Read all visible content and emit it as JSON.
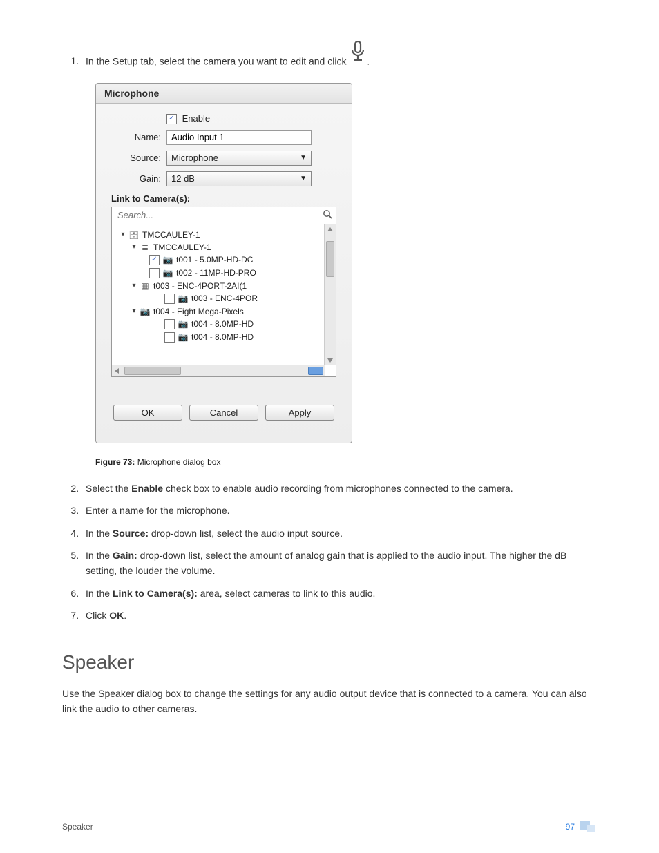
{
  "steps": {
    "s1_pre": "In the Setup tab, select the camera you want to edit and click ",
    "s1_post": ".",
    "s2_pre": "Select the ",
    "s2_b": "Enable",
    "s2_post": " check box to enable audio recording from microphones connected to the camera.",
    "s3": "Enter a name for the microphone.",
    "s4_pre": "In the ",
    "s4_b": "Source:",
    "s4_post": " drop-down list, select the audio input source.",
    "s5_pre": "In the ",
    "s5_b": "Gain:",
    "s5_post": " drop-down list, select the amount of analog gain that is applied to the audio input. The higher the dB setting, the louder the volume.",
    "s6_pre": "In the ",
    "s6_b": "Link to Camera(s):",
    "s6_post": " area, select cameras to link to this audio.",
    "s7_pre": "Click ",
    "s7_b": "OK",
    "s7_post": "."
  },
  "dialog": {
    "title": "Microphone",
    "enable_label": "Enable",
    "name_label": "Name:",
    "name_value": "Audio Input 1",
    "source_label": "Source:",
    "source_value": "Microphone",
    "gain_label": "Gain:",
    "gain_value": "12 dB",
    "link_heading": "Link to Camera(s):",
    "search_placeholder": "Search...",
    "tree": {
      "n0": "TMCCAULEY-1",
      "n1": "TMCCAULEY-1",
      "n2": "t001 - 5.0MP-HD-DC",
      "n3": "t002 - 11MP-HD-PRO",
      "n4": "t003 - ENC-4PORT-2AI(1",
      "n5": "t003 - ENC-4POR",
      "n6": "t004 - Eight Mega-Pixels",
      "n7": "t004 - 8.0MP-HD",
      "n8": "t004 - 8.0MP-HD"
    },
    "ok": "OK",
    "cancel": "Cancel",
    "apply": "Apply"
  },
  "fig": {
    "label": "Figure 73:",
    "caption": " Microphone dialog box"
  },
  "section": {
    "heading": "Speaker",
    "body": "Use the Speaker dialog box to change the settings for any audio output device that is connected to a camera. You can also link the audio to other cameras."
  },
  "footer": {
    "left": "Speaker",
    "page": "97"
  }
}
